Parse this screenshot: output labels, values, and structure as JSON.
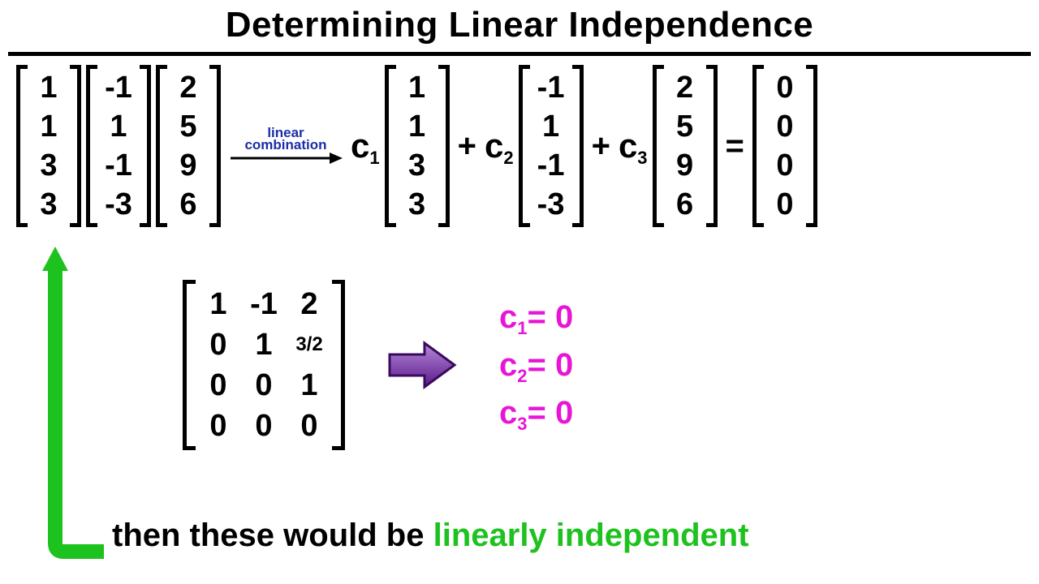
{
  "title": "Determining Linear Independence",
  "vectors": {
    "v1": [
      "1",
      "1",
      "3",
      "3"
    ],
    "v2": [
      "-1",
      "1",
      "-1",
      "-3"
    ],
    "v3": [
      "2",
      "5",
      "9",
      "6"
    ],
    "zero": [
      "0",
      "0",
      "0",
      "0"
    ]
  },
  "arrow_label_line1": "linear",
  "arrow_label_line2": "combination",
  "coefs": {
    "c1": "c",
    "c2": "c",
    "c3": "c",
    "s1": "1",
    "s2": "2",
    "s3": "3"
  },
  "ops": {
    "plus": "+",
    "eq": "="
  },
  "matrix": {
    "rows": [
      [
        "1",
        "-1",
        "2"
      ],
      [
        "0",
        "1",
        "3/2"
      ],
      [
        "0",
        "0",
        "1"
      ],
      [
        "0",
        "0",
        "0"
      ]
    ]
  },
  "solutions": {
    "lines": [
      {
        "var": "c",
        "sub": "1",
        "rhs": " = 0"
      },
      {
        "var": "c",
        "sub": "2",
        "rhs": " = 0"
      },
      {
        "var": "c",
        "sub": "3",
        "rhs": " = 0"
      }
    ]
  },
  "bottom": {
    "prefix": "then these would be ",
    "highlight": "linearly independent"
  }
}
